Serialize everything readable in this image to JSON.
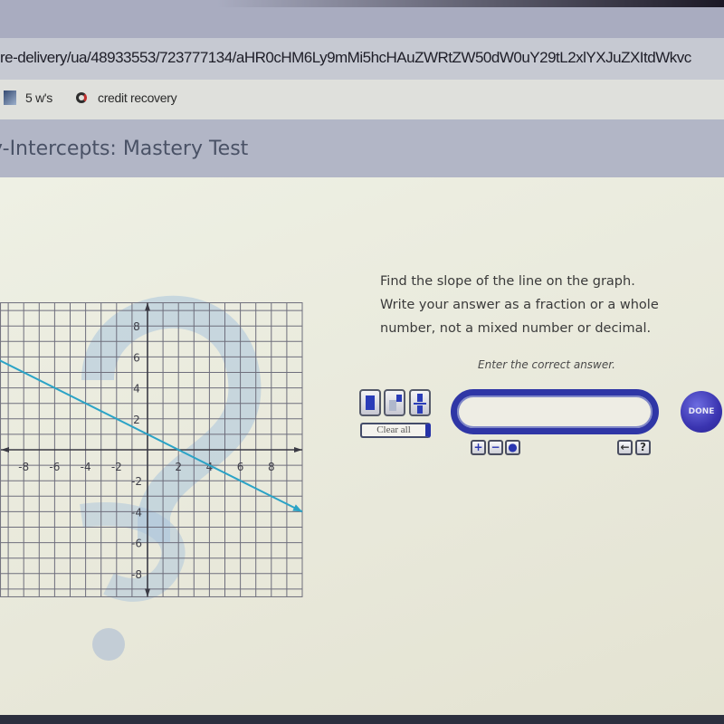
{
  "browser": {
    "url": "re-delivery/ua/48933553/723777134/aHR0cHM6Ly9mMi5hcHAuZWRtZW50dW0uY29tL2xlYXJuZXItdWkvc",
    "bookmarks": [
      {
        "label": "5 w's",
        "icon": "bookmark-5ws-icon"
      },
      {
        "label": "credit recovery",
        "icon": "edge-browser-icon"
      }
    ]
  },
  "page": {
    "title": "y-Intercepts: Mastery Test"
  },
  "question": {
    "lines": [
      "Find the slope of the line on the graph.",
      "Write your answer as a fraction or a whole",
      "number, not a mixed number or decimal."
    ],
    "instruction": "Enter the correct answer."
  },
  "answer": {
    "value": "",
    "clear_all_label": "Clear all",
    "done_label": "DONE",
    "tools": [
      "whole-number-icon",
      "exponent-icon",
      "fraction-icon"
    ],
    "mini_buttons": [
      "+",
      "−",
      "●"
    ],
    "nav_buttons": [
      "←",
      "?"
    ]
  },
  "colors": {
    "accent": "#2f36a6",
    "line": "#2ba3c6"
  },
  "chart_data": {
    "type": "line",
    "title": "",
    "xlabel": "",
    "ylabel": "",
    "xlim": [
      -9.5,
      10
    ],
    "ylim": [
      -9.5,
      9.5
    ],
    "grid": true,
    "x_ticks": [
      -8,
      -6,
      -4,
      -2,
      2,
      4,
      6,
      8
    ],
    "y_ticks": [
      8,
      6,
      4,
      2,
      -2,
      -4,
      -6,
      -8
    ],
    "series": [
      {
        "name": "line",
        "points": [
          [
            -9.6,
            5.8
          ],
          [
            0,
            1
          ],
          [
            2,
            0
          ],
          [
            10,
            -4
          ]
        ],
        "slope": "-1/2"
      }
    ]
  }
}
